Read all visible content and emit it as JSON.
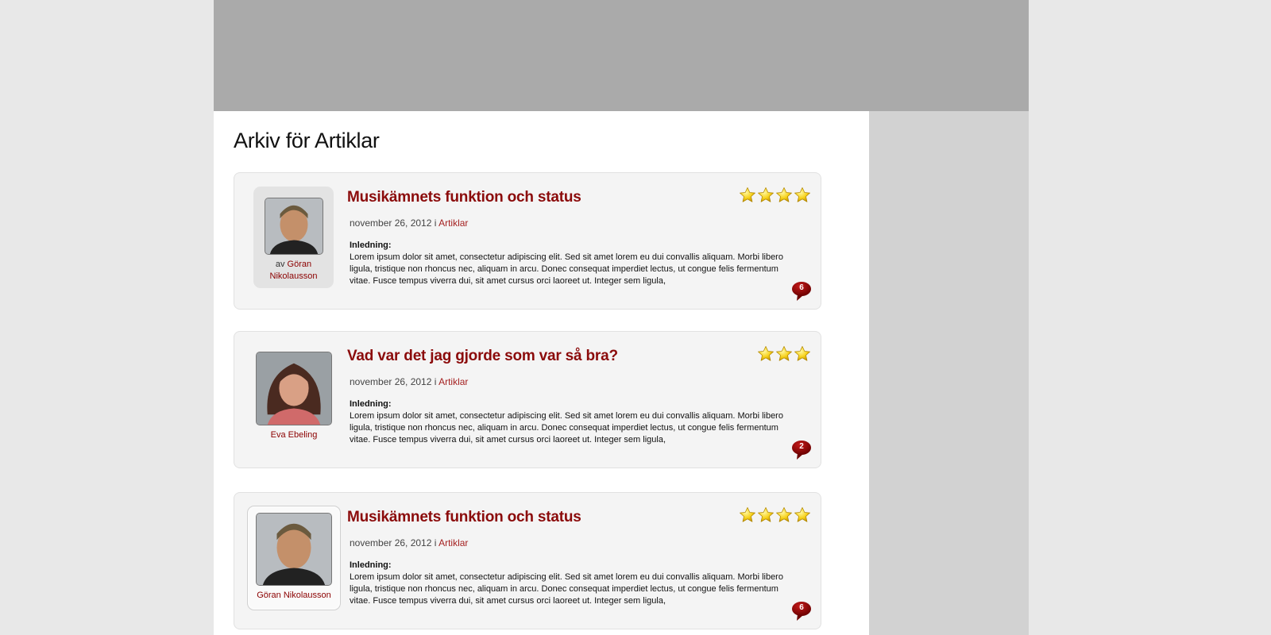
{
  "page": {
    "title": "Arkiv för Artiklar"
  },
  "colors": {
    "accent": "#8b0b0b",
    "header_bg": "#aaaaaa",
    "sidebar_bg": "#d2d2d2",
    "card_bg": "#f4f4f4",
    "star": "#f7d21c"
  },
  "icons": {
    "rating": "star-icon",
    "comments": "speech-bubble-icon"
  },
  "posts": [
    {
      "title": "Musikämnets funktion och status",
      "date": "november 26, 2012",
      "meta_separator": " i ",
      "category": "Artiklar",
      "author_prefix": "av ",
      "author": "Göran Nikolausson",
      "excerpt_label": "Inledning:",
      "excerpt": "Lorem ipsum dolor sit amet, consectetur adipiscing elit. Sed sit amet lorem eu dui convallis aliquam. Morbi libero ligula, tristique non rhoncus nec, aliquam in arcu. Donec consequat imperdiet lectus, ut congue felis fermentum vitae. Fusce tempus viverra dui, sit amet cursus orci laoreet ut. Integer sem ligula,",
      "rating": 4,
      "comments": "6"
    },
    {
      "title": "Vad var det jag gjorde som var så bra?",
      "date": "november 26, 2012",
      "meta_separator": " i ",
      "category": "Artiklar",
      "author_prefix": "",
      "author": "Eva Ebeling",
      "excerpt_label": "Inledning:",
      "excerpt": "Lorem ipsum dolor sit amet, consectetur adipiscing elit. Sed sit amet lorem eu dui convallis aliquam. Morbi libero ligula, tristique non rhoncus nec, aliquam in arcu. Donec consequat imperdiet lectus, ut congue felis fermentum vitae. Fusce tempus viverra dui, sit amet cursus orci laoreet ut. Integer sem ligula,",
      "rating": 3,
      "comments": "2"
    },
    {
      "title": "Musikämnets funktion och status",
      "date": "november 26, 2012",
      "meta_separator": " i ",
      "category": "Artiklar",
      "author_prefix": "",
      "author": "Göran Nikolausson",
      "excerpt_label": "Inledning:",
      "excerpt": "Lorem ipsum dolor sit amet, consectetur adipiscing elit. Sed sit amet lorem eu dui convallis aliquam. Morbi libero ligula, tristique non rhoncus nec, aliquam in arcu. Donec consequat imperdiet lectus, ut congue felis fermentum vitae. Fusce tempus viverra dui, sit amet cursus orci laoreet ut. Integer sem ligula,",
      "rating": 4,
      "comments": "6"
    }
  ]
}
